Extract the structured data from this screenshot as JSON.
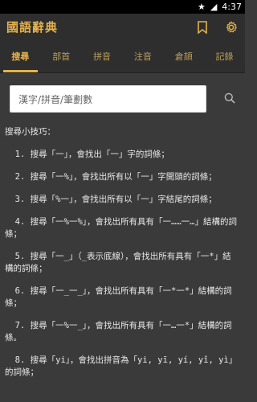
{
  "statusbar": {
    "time": "4:37"
  },
  "appbar": {
    "title": "國語辭典"
  },
  "tabs": [
    "搜尋",
    "部首",
    "拼音",
    "注音",
    "倉頡",
    "記錄"
  ],
  "search": {
    "placeholder": "漢字/拼音/筆劃數"
  },
  "tips": {
    "title": "搜尋小技巧：",
    "items": [
      "  1. 搜尋「一」，會找出「一」字的詞條；",
      "  2. 搜尋「一%」，會找出所有以「一」字開頭的詞條；",
      "  3. 搜尋「%一」，會找出所有以「一」字結尾的詞條；",
      "  4. 搜尋「一%一%」，會找出所有具有「一……一…」結構的詞條；",
      "  5. 搜尋「一_」（_表示底線），會找出所有具有「一*」結構的詞條；",
      "  6. 搜尋「一_一_」，會找出所有具有「一*一*」結構的詞條；",
      "  7. 搜尋「一%一_」，會找出所有具有「一…一*」結構的詞條。",
      "  8. 搜尋「yi」，會找出拼音為「yi, yī, yí, yǐ, yì」的詞條；"
    ]
  }
}
